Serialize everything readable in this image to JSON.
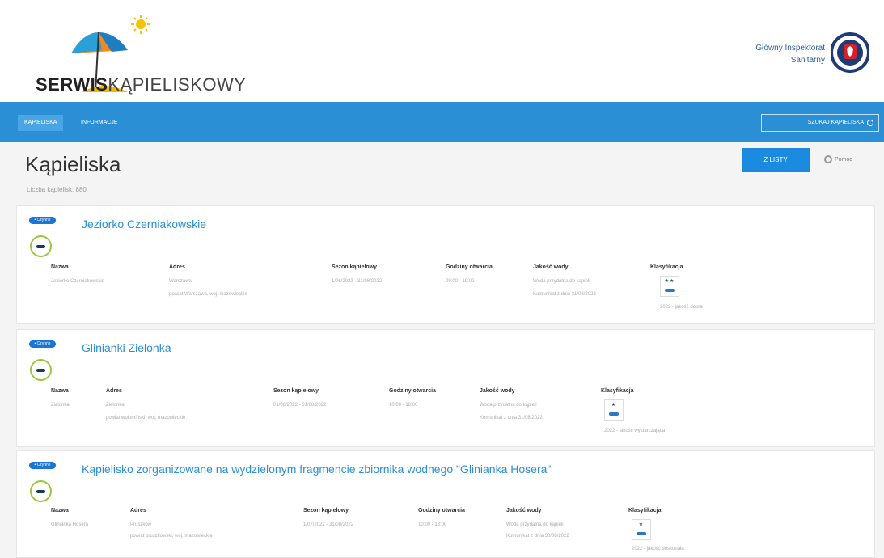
{
  "header": {
    "logo_bold": "SERWIS",
    "logo_light": "KĄPIELISKOWY",
    "gis_line1": "Główny Inspektorat",
    "gis_line2": "Sanitarny"
  },
  "nav": {
    "items": [
      {
        "label": "Kąpieliska"
      },
      {
        "label": "Informacje"
      }
    ],
    "search_label": "Szukaj kąpieliska"
  },
  "page": {
    "title": "Kąpieliska",
    "count": "Liczba kąpielisk: 880",
    "list_button": "Z listy",
    "help": "Pomoc"
  },
  "labels": {
    "name": "Nazwa",
    "address": "Adres",
    "season": "Sezon kąpielowy",
    "hours": "Godziny otwarcia",
    "quality": "Jakość wody",
    "classification": "Klasyfikacja"
  },
  "cards": [
    {
      "badge": "• Czynne",
      "title": "Jeziorko Czerniakowskie",
      "name": "Jeziorko Czerniakowskie",
      "address_1": "Warszawa",
      "address_2": "powiat Warszawa, woj. mazowieckie",
      "season": "1/06/2022 - 31/08/2022",
      "hours": "09:00 - 19:00",
      "quality_1": "Woda przydatna do kąpieli",
      "quality_2": "Komunikat z dnia 31/08/2022",
      "class_text": "2022 - jakość dobra",
      "stars": "★★"
    },
    {
      "badge": "• Czynne",
      "title": "Glinianki Zielonka",
      "name": "Zielonka",
      "address_1": "Zielonka",
      "address_2": "powiat wołomiński, woj. mazowieckie",
      "season": "01/06/2022 - 31/08/2022",
      "hours": "10:00 - 18:00",
      "quality_1": "Woda przydatna do kąpieli",
      "quality_2": "Komunikat z dnia 31/08/2022",
      "class_text": "2022 - jakość wystarczająca",
      "stars": "★"
    },
    {
      "badge": "• Czynne",
      "title": "Kąpielisko zorganizowane na wydzielonym fragmencie zbiornika wodnego \"Glinianka Hosera\"",
      "name": "Glinianka Hosera",
      "address_1": "Pruszków",
      "address_2": "powiat pruszkowski, woj. mazowieckie",
      "season": "1/07/2022 - 31/08/2022",
      "hours": "10:00 - 18:00",
      "quality_1": "Woda przydatna do kąpieli",
      "quality_2": "Komunikat z dnia 30/08/2022",
      "class_text": "2022 - jakość doskonała",
      "stars": "★"
    }
  ],
  "colors": {
    "nav": "#2b8fd6",
    "accent": "#1a8be0",
    "title_link": "#2a8fd6"
  }
}
